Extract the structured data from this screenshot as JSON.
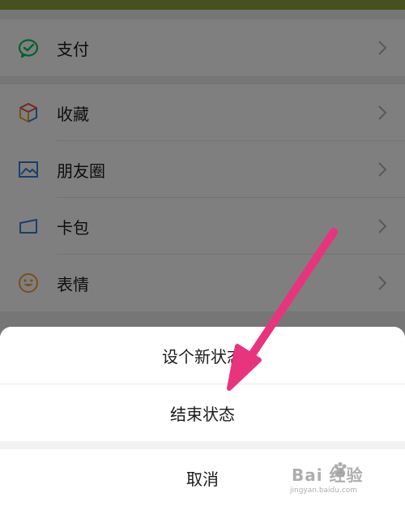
{
  "menu": {
    "items": [
      {
        "label": "支付",
        "icon": "wechat-pay-icon"
      },
      {
        "label": "收藏",
        "icon": "favorites-cube-icon"
      },
      {
        "label": "朋友圈",
        "icon": "moments-image-icon"
      },
      {
        "label": "卡包",
        "icon": "card-wallet-icon"
      },
      {
        "label": "表情",
        "icon": "emoji-smile-icon"
      }
    ]
  },
  "action_sheet": {
    "set_new_status": "设个新状态",
    "end_status": "结束状态",
    "cancel": "取消"
  },
  "colors": {
    "pay_green": "#07c160",
    "icon_blue": "#2f7fd8",
    "icon_orange": "#f0a030",
    "arrow_pink": "#e8347c",
    "top_strip": "#8fa23a"
  },
  "watermark": {
    "main": "Bai 经验",
    "sub": "jingyan.baidu.com"
  }
}
